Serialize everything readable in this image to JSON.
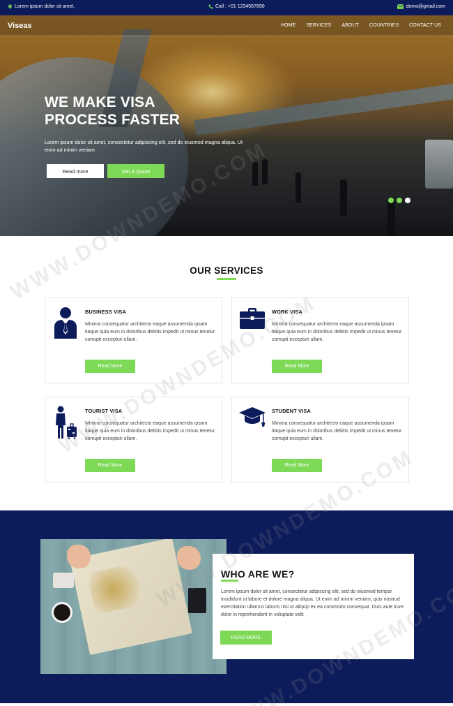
{
  "topbar": {
    "address": "Lorem ipsum dolor sit amet,",
    "phone": "Call : +01 1234567890",
    "email": "demo@gmail.com"
  },
  "nav": {
    "brand": "Viseas",
    "items": [
      "HOME",
      "SERVICES",
      "ABOUT",
      "COUNTRIES",
      "CONTACT US"
    ]
  },
  "hero": {
    "title_line1": "WE MAKE VISA",
    "title_line2": "PROCESS FASTER",
    "text": "Lorem ipsum dolor sit amet, consectetur adipiscing elit, sed do eiusmod magna aliqua. Ut enim ad minim veniam",
    "btn_readmore": "Read more",
    "btn_quote": "Get A Quote",
    "slides": 3,
    "active_slide": 3
  },
  "services": {
    "title": "OUR SERVICES",
    "cards": [
      {
        "title": "BUSINESS VISA",
        "text": "Minima consequatur architecto eaque assumenda ipsam itaque quia eum in doloribus debitis impedit ut minus tenetur corrupti excepturi ullam.",
        "button": "Read More",
        "icon": "businessman-icon"
      },
      {
        "title": "WORK VISA",
        "text": "Minima consequatur architecto eaque assumenda ipsam itaque quia eum in doloribus debitis impedit ut minus tenetur corrupti excepturi ullam.",
        "button": "Read More",
        "icon": "briefcase-icon"
      },
      {
        "title": "TOURIST VISA",
        "text": "Minima consequatur architecto eaque assumenda ipsam itaque quia eum in doloribus debitis impedit ut minus tenetur corrupti excepturi ullam.",
        "button": "Read More",
        "icon": "traveler-luggage-icon"
      },
      {
        "title": "STUDENT VISA",
        "text": "Minima consequatur architecto eaque assumenda ipsam itaque quia eum in doloribus debitis impedit ut minus tenetur corrupti excepturi ullam.",
        "button": "Read More",
        "icon": "graduation-cap-icon"
      }
    ]
  },
  "about": {
    "title": "WHO ARE WE?",
    "text": "Lorem ipsum dolor sit amet, consectetur adipiscing elit, sed do eiusmod tempor incididunt ut labore et dolore magna aliqua. Ut enim ad minim veniam, quis nostrud exercitation ullamco laboris nisi ut aliquip ex ea commodo consequat. Duis aute irure dolor in reprehenderit in voluptate velit",
    "button": "READ MORE"
  },
  "watermark": "WWW.DOWNDEMO.COM",
  "colors": {
    "navy": "#0c1b5a",
    "accent": "#7ed957"
  }
}
